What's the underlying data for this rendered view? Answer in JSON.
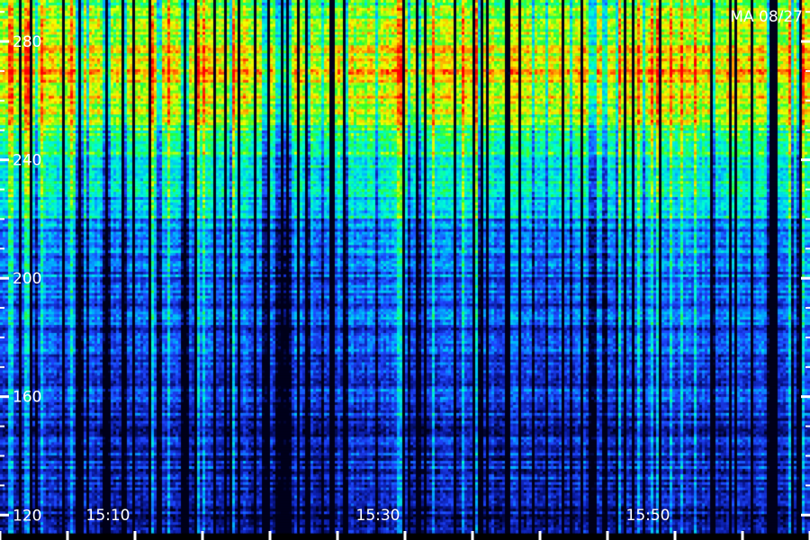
{
  "chart_data": {
    "type": "heatmap",
    "title": "MA 08/27",
    "xlabel": "",
    "ylabel": "",
    "x_start": "15:02",
    "x_end": "16:02",
    "x_ticks": [
      "15:10",
      "15:30",
      "15:50"
    ],
    "y_ticks": [
      120,
      160,
      200,
      240,
      280
    ],
    "ylim": [
      114,
      294
    ],
    "colormap": [
      "#00001a",
      "#0a1aa0",
      "#1e46ff",
      "#00b4ff",
      "#00ffd2",
      "#2cff2c",
      "#f5ff00",
      "#ff8c00",
      "#ff0000"
    ],
    "bands": [
      {
        "y_from": 250,
        "y_to": 292,
        "level": "high"
      },
      {
        "y_from": 220,
        "y_to": 250,
        "level": "medium"
      },
      {
        "y_from": 114,
        "y_to": 220,
        "level": "low"
      }
    ]
  }
}
